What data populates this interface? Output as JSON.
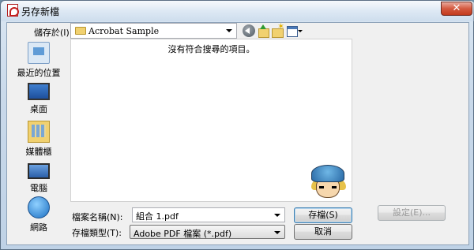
{
  "window": {
    "title": "另存新檔",
    "close_label": "✕"
  },
  "toolbar": {
    "save_in_label": "儲存於",
    "save_in_mnemonic": "(I):",
    "current_folder": "Acrobat Sample"
  },
  "places": [
    {
      "label": "最近的位置",
      "icon": "recent-places-icon"
    },
    {
      "label": "桌面",
      "icon": "desktop-icon"
    },
    {
      "label": "媒體櫃",
      "icon": "libraries-icon"
    },
    {
      "label": "電腦",
      "icon": "computer-icon"
    },
    {
      "label": "網路",
      "icon": "network-icon"
    }
  ],
  "filelist": {
    "empty_message": "沒有符合搜尋的項目。"
  },
  "form": {
    "filename_label": "檔案名稱(N):",
    "filename_value": "組合 1.pdf",
    "filetype_label": "存檔類型(T):",
    "filetype_value": "Adobe PDF 檔案 (*.pdf)"
  },
  "buttons": {
    "save": "存檔(S)",
    "cancel": "取消",
    "settings": "設定(E)..."
  },
  "colors": {
    "accent": "#3c7fb1",
    "close_button": "#c23a1e"
  }
}
